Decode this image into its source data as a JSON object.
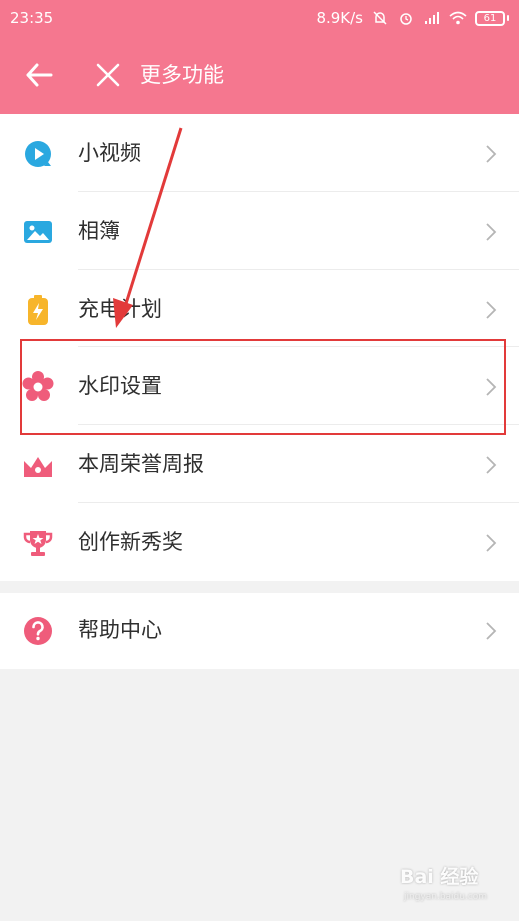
{
  "status": {
    "time": "23:35",
    "speed": "8.9K/s",
    "battery": "61"
  },
  "toolbar": {
    "title": "更多功能"
  },
  "menu": {
    "items": [
      {
        "label": "小视频",
        "icon": "play-icon"
      },
      {
        "label": "相簿",
        "icon": "image-icon"
      },
      {
        "label": "充电计划",
        "icon": "battery-bolt-icon"
      },
      {
        "label": "水印设置",
        "icon": "flower-icon"
      },
      {
        "label": "本周荣誉周报",
        "icon": "crown-icon"
      },
      {
        "label": "创作新秀奖",
        "icon": "trophy-icon"
      }
    ]
  },
  "help": {
    "label": "帮助中心",
    "icon": "question-icon"
  },
  "watermark": {
    "text": "Bai 经验",
    "sub": "jingyan.baidu.com"
  },
  "colors": {
    "accent": "#f5778f",
    "annotation": "#e23a3a",
    "blue": "#2aa8e0",
    "yellow": "#f7b52b",
    "pink": "#ef5c7b"
  }
}
